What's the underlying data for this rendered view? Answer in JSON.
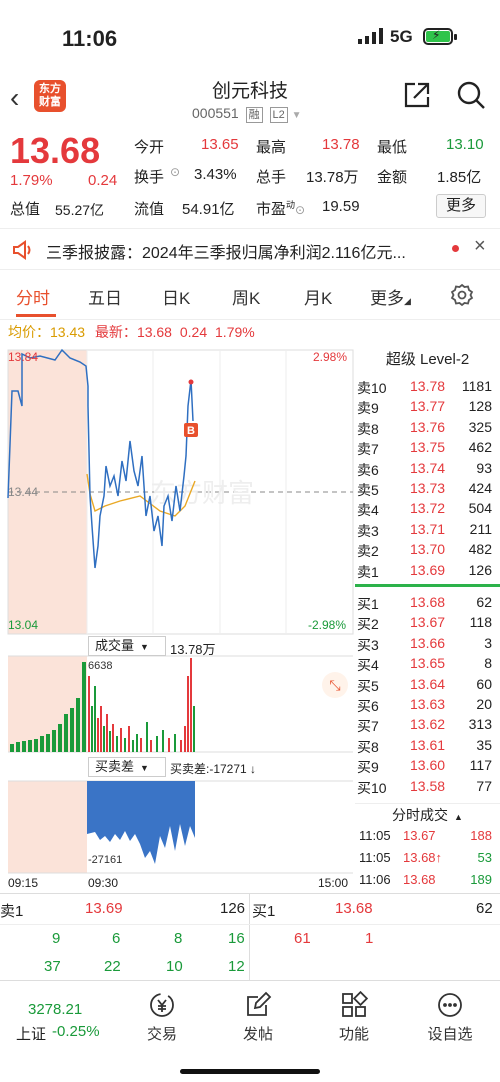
{
  "status": {
    "time": "11:06",
    "network": "5G"
  },
  "header": {
    "title": "创元科技",
    "code": "000551",
    "tag1": "融",
    "tag2": "L2",
    "logo_line1": "东方",
    "logo_line2": "财富"
  },
  "quote": {
    "price": "13.68",
    "pct": "1.79%",
    "change": "0.24",
    "open_label": "今开",
    "open": "13.65",
    "high_label": "最高",
    "high": "13.78",
    "low_label": "最低",
    "low": "13.10",
    "turnover_label": "换手",
    "turnover": "3.43%",
    "volume_label": "总手",
    "volume": "13.78万",
    "amount_label": "金额",
    "amount": "1.85亿",
    "total_label": "总值",
    "total": "55.27亿",
    "float_label": "流值",
    "float": "54.91亿",
    "pe_label": "市盈",
    "pe_sup": "动",
    "pe": "19.59",
    "more": "更多"
  },
  "notice": {
    "text": "三季报披露：2024年三季报归属净利润2.116亿元..."
  },
  "tabs": [
    "分时",
    "五日",
    "日K",
    "周K",
    "月K",
    "更多"
  ],
  "avgline": {
    "avg_label": "均价：",
    "avg": "13.43",
    "latest_label": "最新：",
    "latest": "13.68",
    "chg": "0.24",
    "pct": "1.79%"
  },
  "chart": {
    "top_price": "13.84",
    "mid_price": "13.44",
    "low_price": "13.04",
    "top_pct": "2.98%",
    "low_pct": "-2.98%",
    "vol_label": "成交量",
    "vol_value": "13.78万",
    "vol_max": "6638",
    "diff_label": "买卖差",
    "diff_value": "买卖差:-17271 ↓",
    "diff_min": "-27161",
    "t_start": "09:15",
    "t_open": "09:30",
    "t_mid": "15:00",
    "marker": "B",
    "watermark": "东方财富"
  },
  "orderbook": {
    "title": "超级 Level-2",
    "asks": [
      {
        "label": "卖10",
        "price": "13.78",
        "qty": "1181"
      },
      {
        "label": "卖9",
        "price": "13.77",
        "qty": "128"
      },
      {
        "label": "卖8",
        "price": "13.76",
        "qty": "325"
      },
      {
        "label": "卖7",
        "price": "13.75",
        "qty": "462"
      },
      {
        "label": "卖6",
        "price": "13.74",
        "qty": "93"
      },
      {
        "label": "卖5",
        "price": "13.73",
        "qty": "424"
      },
      {
        "label": "卖4",
        "price": "13.72",
        "qty": "504"
      },
      {
        "label": "卖3",
        "price": "13.71",
        "qty": "211"
      },
      {
        "label": "卖2",
        "price": "13.70",
        "qty": "482"
      },
      {
        "label": "卖1",
        "price": "13.69",
        "qty": "126"
      }
    ],
    "bids": [
      {
        "label": "买1",
        "price": "13.68",
        "qty": "62"
      },
      {
        "label": "买2",
        "price": "13.67",
        "qty": "118"
      },
      {
        "label": "买3",
        "price": "13.66",
        "qty": "3"
      },
      {
        "label": "买4",
        "price": "13.65",
        "qty": "8"
      },
      {
        "label": "买5",
        "price": "13.64",
        "qty": "60"
      },
      {
        "label": "买6",
        "price": "13.63",
        "qty": "20"
      },
      {
        "label": "买7",
        "price": "13.62",
        "qty": "313"
      },
      {
        "label": "买8",
        "price": "13.61",
        "qty": "35"
      },
      {
        "label": "买9",
        "price": "13.60",
        "qty": "117"
      },
      {
        "label": "买10",
        "price": "13.58",
        "qty": "77"
      }
    ],
    "trades_title": "分时成交",
    "trades": [
      {
        "time": "11:05",
        "price": "13.67",
        "qty": "188",
        "color": "red"
      },
      {
        "time": "11:05",
        "price": "13.68↑",
        "qty": "53",
        "color": "green"
      },
      {
        "time": "11:06",
        "price": "13.68",
        "qty": "189",
        "color": "green"
      }
    ]
  },
  "book_bottom": {
    "sell_label": "卖1",
    "sell_price": "13.69",
    "sell_qty": "126",
    "buy_label": "买1",
    "buy_price": "13.68",
    "buy_qty": "62",
    "sell_row1": [
      "9",
      "6",
      "8",
      "16"
    ],
    "sell_row2": [
      "37",
      "22",
      "10",
      "12"
    ],
    "buy_row1": [
      "61",
      "1"
    ]
  },
  "nav": {
    "index_value": "3278.21",
    "index_name": "上证",
    "index_pct": "-0.25%",
    "items": [
      "交易",
      "发帖",
      "功能",
      "设自选"
    ]
  }
}
